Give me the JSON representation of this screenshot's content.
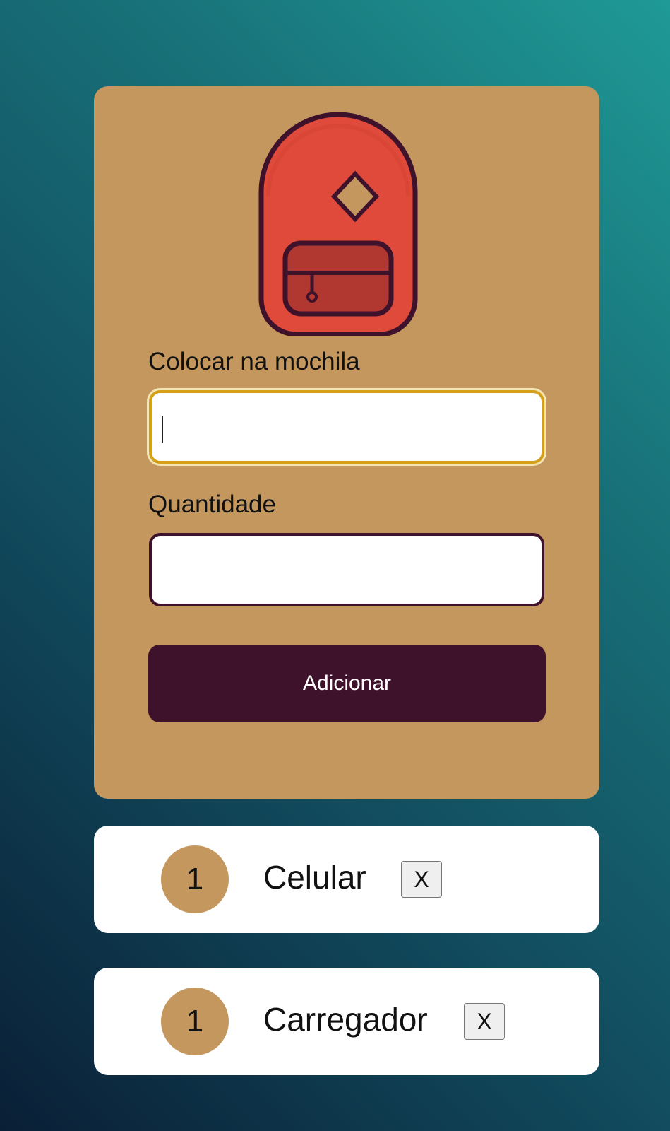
{
  "form": {
    "item_label": "Colocar na mochila",
    "item_value": "",
    "quantity_label": "Quantidade",
    "quantity_value": "",
    "submit_label": "Adicionar"
  },
  "list": [
    {
      "quantity": "1",
      "name": "Celular",
      "remove_label": "X"
    },
    {
      "quantity": "1",
      "name": "Carregador",
      "remove_label": "X"
    }
  ],
  "colors": {
    "card": "#c4975f",
    "button": "#3f122b",
    "backpack": "#e04a3a",
    "focus_border": "#d4a017"
  },
  "icons": {
    "logo": "backpack-icon"
  }
}
